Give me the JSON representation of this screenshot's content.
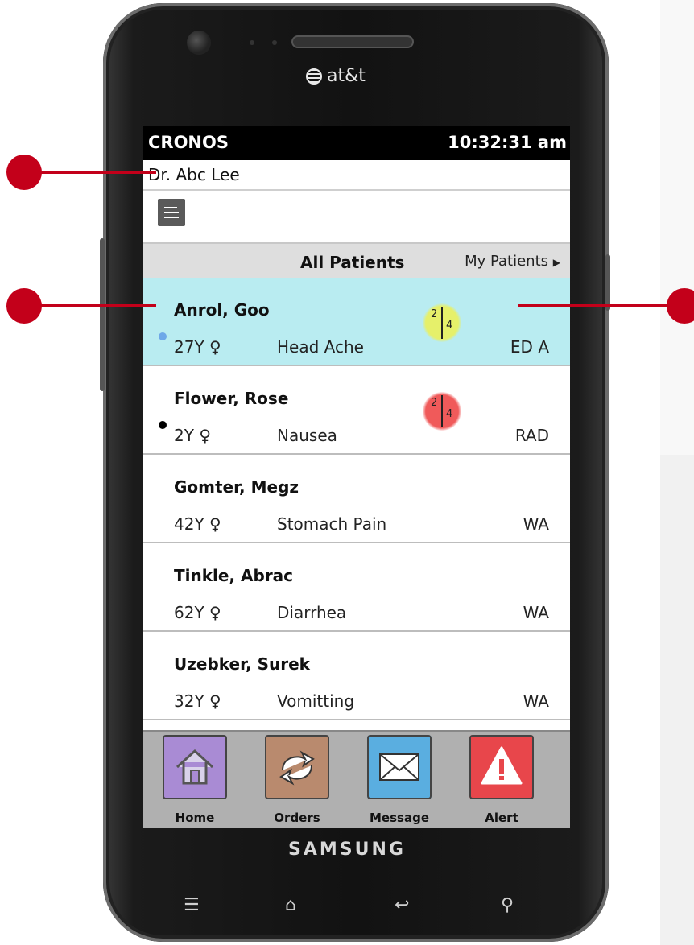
{
  "device": {
    "carrier": "at&t",
    "brand": "SAMSUNG"
  },
  "status_bar": {
    "app_name": "CRONOS",
    "time": "10:32:31 am"
  },
  "user": {
    "name": "Dr. Abc Lee"
  },
  "filter": {
    "active": "All Patients",
    "other": "My Patients"
  },
  "patients": [
    {
      "name": "Anrol, Goo",
      "age": "27Y",
      "sex_symbol": "♀",
      "complaint": "Head Ache",
      "location": "ED A",
      "selected": true,
      "indicator_color": "#6ea8e8",
      "triage": {
        "left": "2",
        "right": "4",
        "color": "#e6f06a"
      }
    },
    {
      "name": "Flower, Rose",
      "age": "2Y",
      "sex_symbol": "♀",
      "complaint": "Nausea",
      "location": "RAD",
      "selected": false,
      "indicator_color": "#000000",
      "triage": {
        "left": "2",
        "right": "4",
        "color": "#f05a5a"
      }
    },
    {
      "name": "Gomter, Megz",
      "age": "42Y",
      "sex_symbol": "♀",
      "complaint": "Stomach Pain",
      "location": "WA",
      "selected": false
    },
    {
      "name": "Tinkle, Abrac",
      "age": "62Y",
      "sex_symbol": "♀",
      "complaint": "Diarrhea",
      "location": "WA",
      "selected": false
    },
    {
      "name": "Uzebker, Surek",
      "age": "32Y",
      "sex_symbol": "♀",
      "complaint": "Vomitting",
      "location": "WA",
      "selected": false
    }
  ],
  "dock": [
    {
      "label": "Home",
      "icon": "home-icon",
      "color": "#a98bd4"
    },
    {
      "label": "Orders",
      "icon": "refresh-arrows-icon",
      "color": "#b98a6e"
    },
    {
      "label": "Message",
      "icon": "envelope-icon",
      "color": "#5aaee0"
    },
    {
      "label": "Alert",
      "icon": "warning-icon",
      "color": "#e8464b"
    }
  ],
  "colors": {
    "accent_callout": "#c3001a",
    "selected_row": "#b9ecf1"
  }
}
